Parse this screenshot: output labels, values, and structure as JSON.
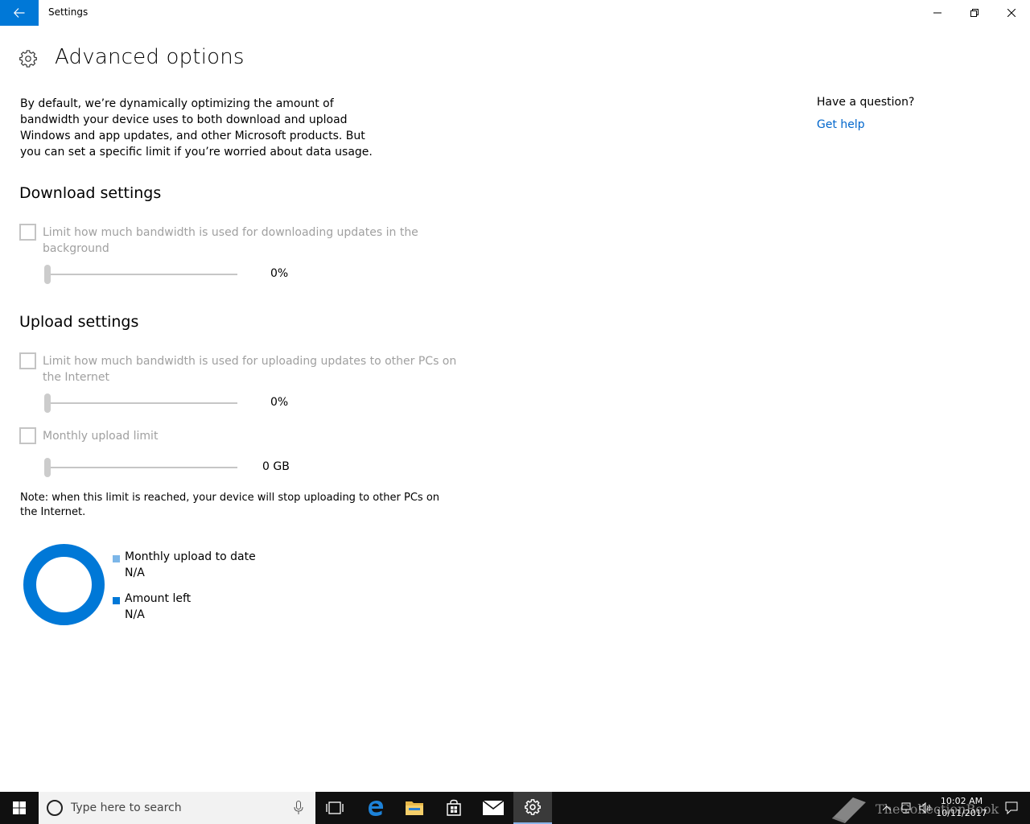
{
  "window": {
    "title": "Settings",
    "back_icon": "arrow-left-icon",
    "minimize_icon": "minimize-icon",
    "maximize_icon": "restore-icon",
    "close_icon": "close-icon"
  },
  "page": {
    "icon": "gear-icon",
    "title": "Advanced options",
    "intro": "By default, we’re dynamically optimizing the amount of bandwidth your device uses to both download and upload Windows and app updates, and other Microsoft products. But you can set a specific limit if you’re worried about data usage."
  },
  "download": {
    "heading": "Download settings",
    "limit_label": "Limit how much bandwidth is used for downloading updates in the background",
    "limit_checked": false,
    "slider_value": "0%"
  },
  "upload": {
    "heading": "Upload settings",
    "limit_label": "Limit how much bandwidth is used for uploading updates to other PCs on the Internet",
    "limit_checked": false,
    "slider_value": "0%",
    "monthly_label": "Monthly upload limit",
    "monthly_checked": false,
    "monthly_value": "0 GB",
    "note": "Note: when this limit is reached, your device will stop uploading to other PCs on the Internet."
  },
  "usage": {
    "items": [
      {
        "label": "Monthly upload to date",
        "value": "N/A",
        "color": "#7cb6e8"
      },
      {
        "label": "Amount left",
        "value": "N/A",
        "color": "#0078d7"
      }
    ]
  },
  "help": {
    "question": "Have a question?",
    "link": "Get help"
  },
  "taskbar": {
    "search_placeholder": "Type here to search",
    "apps": [
      "task-view-icon",
      "edge-icon",
      "file-explorer-icon",
      "store-icon",
      "mail-icon",
      "settings-icon"
    ],
    "watermark": "TheCollectionBook",
    "time": "10:02 AM",
    "date": "10/11/2017"
  },
  "colors": {
    "accent": "#0078d7",
    "link": "#0066cc",
    "disabled_text": "#a0a0a0",
    "taskbar": "#101010"
  }
}
